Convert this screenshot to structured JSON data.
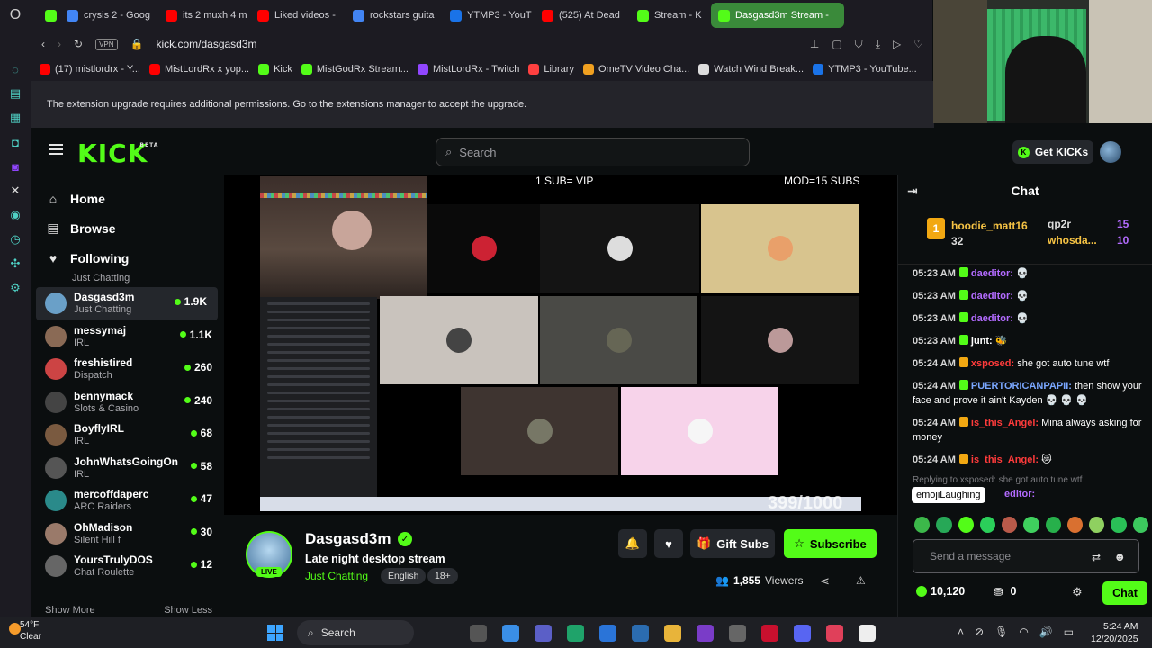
{
  "browser": {
    "tabs": [
      {
        "label": "",
        "color": "#53fc18"
      },
      {
        "label": "crysis 2 - Goog",
        "color": "#4285f4"
      },
      {
        "label": "its 2 muxh 4 m",
        "color": "#ff0000"
      },
      {
        "label": "Liked videos -",
        "color": "#ff0000"
      },
      {
        "label": "rockstars guita",
        "color": "#4285f4"
      },
      {
        "label": "YTMP3 - YouT",
        "color": "#1a73e8"
      },
      {
        "label": "(525) At Dead",
        "color": "#ff0000"
      },
      {
        "label": "Stream - K",
        "color": "#53fc18"
      },
      {
        "label": "Dasgasd3m Stream -",
        "color": "#53fc18",
        "active": true
      }
    ],
    "vpn_label": "VPN",
    "url": "kick.com/dasgasd3m",
    "bookmarks": [
      {
        "label": "(17) mistlordrx - Y...",
        "color": "#ff0000"
      },
      {
        "label": "MistLordRx x yop...",
        "color": "#ff0000"
      },
      {
        "label": "Kick",
        "color": "#53fc18"
      },
      {
        "label": "MistGodRx Stream...",
        "color": "#53fc18"
      },
      {
        "label": "MistLordRx - Twitch",
        "color": "#9146ff"
      },
      {
        "label": "Library",
        "color": "#ff4040"
      },
      {
        "label": "OmeTV Video Cha...",
        "color": "#f0a020"
      },
      {
        "label": "Watch Wind Break...",
        "color": "#dddddd"
      },
      {
        "label": "YTMP3 - YouTube...",
        "color": "#1a73e8"
      }
    ],
    "banner": "The extension upgrade requires additional permissions. Go to the extensions manager to accept the upgrade."
  },
  "kick": {
    "logo": "KICK",
    "logo_sup": "BETA",
    "search_placeholder": "Search",
    "get_kicks": "Get KICKs",
    "nav": [
      {
        "label": "Home",
        "icon": "home-icon"
      },
      {
        "label": "Browse",
        "icon": "browse-icon"
      },
      {
        "label": "Following",
        "icon": "heart-icon"
      }
    ],
    "partial_category": "Just Chatting",
    "channels": [
      {
        "name": "Dasgasd3m",
        "category": "Just Chatting",
        "viewers": "1.9K",
        "color": "#6aa0c8",
        "selected": true
      },
      {
        "name": "messymaj",
        "category": "IRL",
        "viewers": "1.1K",
        "color": "#8a6a55"
      },
      {
        "name": "freshistired",
        "category": "Dispatch",
        "viewers": "260",
        "color": "#c44"
      },
      {
        "name": "bennymack",
        "category": "Slots & Casino",
        "viewers": "240",
        "color": "#444"
      },
      {
        "name": "BoyflyIRL",
        "category": "IRL",
        "viewers": "68",
        "color": "#7a5a40"
      },
      {
        "name": "JohnWhatsGoingOn",
        "category": "IRL",
        "viewers": "58",
        "color": "#555"
      },
      {
        "name": "mercoffdaperc",
        "category": "ARC Raiders",
        "viewers": "47",
        "color": "#2a8a8a"
      },
      {
        "name": "OhMadison",
        "category": "Silent Hill f",
        "viewers": "30",
        "color": "#9a7a6a"
      },
      {
        "name": "YoursTrulyDOS",
        "category": "Chat Roulette",
        "viewers": "12",
        "color": "#666"
      }
    ],
    "show_more": "Show More",
    "show_less": "Show Less"
  },
  "video": {
    "cap_left": "1 SUB= VIP",
    "cap_right": "MOD=15 SUBS",
    "counter": "399/1000"
  },
  "stream": {
    "streamer": "Dasgasd3m",
    "live": "LIVE",
    "title": "Late night desktop stream",
    "category": "Just Chatting",
    "tags": [
      "English",
      "18+"
    ],
    "gift_subs": "Gift Subs",
    "subscribe": "Subscribe",
    "viewers": "1,855",
    "viewers_label": "Viewers"
  },
  "chat": {
    "title": "Chat",
    "gifters": [
      {
        "name": "hoodie_matt16",
        "count": "32",
        "rank": "1"
      },
      {
        "name": "qp2r",
        "count": "15"
      },
      {
        "name": "whosda...",
        "count": "10"
      }
    ],
    "messages": [
      {
        "time": "05:23 AM",
        "user": "daeditor:",
        "color": "#b36bff",
        "text": "💀"
      },
      {
        "time": "05:23 AM",
        "user": "daeditor:",
        "color": "#b36bff",
        "text": "💀"
      },
      {
        "time": "05:23 AM",
        "user": "daeditor:",
        "color": "#b36bff",
        "text": "💀"
      },
      {
        "time": "05:23 AM",
        "user": "junt:",
        "color": "#ffffff",
        "text": "🐝"
      },
      {
        "time": "05:24 AM",
        "user": "xsposed:",
        "color": "#ff3b3b",
        "text": "she got auto tune wtf"
      },
      {
        "time": "05:24 AM",
        "user": "PUERTORICANPAPII:",
        "color": "#7aa7ff",
        "text": "then show your face and prove it ain't Kayden 💀 💀 💀"
      },
      {
        "time": "05:24 AM",
        "user": "is_this_Angel:",
        "color": "#ff3b3b",
        "text": "Mina always asking for money"
      },
      {
        "time": "05:24 AM",
        "user": "is_this_Angel:",
        "color": "#ff3b3b",
        "text": "😿"
      }
    ],
    "reply": "Replying to xsposed: she got auto tune wtf",
    "tooltip": "emojiLaughing",
    "partial_user": "editor:",
    "input_placeholder": "Send a message",
    "kicks": "10,120",
    "points": "0",
    "send": "Chat"
  },
  "taskbar": {
    "temp": "54°F",
    "weather": "Clear",
    "search": "Search",
    "time": "5:24 AM",
    "date": "12/20/2025"
  }
}
